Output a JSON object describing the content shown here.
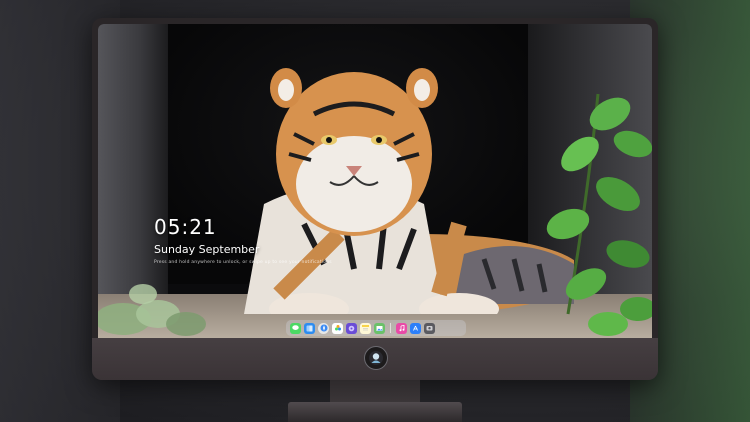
{
  "lockscreen": {
    "time": "05:21",
    "date": "Sunday September",
    "subtext": "Press and hold anywhere to unlock, or swipe up to see your notifications"
  },
  "dock": {
    "apps": [
      {
        "name": "messages-icon",
        "color": "#4cd964"
      },
      {
        "name": "finder-icon",
        "color": "#2d8cf0"
      },
      {
        "name": "safari-icon",
        "color": "#e8e8e8"
      },
      {
        "name": "photos-icon",
        "color": "#f5a623"
      },
      {
        "name": "imovie-icon",
        "color": "#6a4cd6"
      },
      {
        "name": "notes-icon",
        "color": "#f7d34a"
      },
      {
        "name": "preview-icon",
        "color": "#6bc16a"
      },
      {
        "name": "music-icon",
        "color": "#e94aa7"
      },
      {
        "name": "app-store-icon",
        "color": "#2d7ff9"
      },
      {
        "name": "camera-icon",
        "color": "#5a5a60"
      }
    ]
  },
  "colors": {
    "monitor": "#2a2628",
    "chin": "#463f42",
    "accent": "#ffffff"
  }
}
